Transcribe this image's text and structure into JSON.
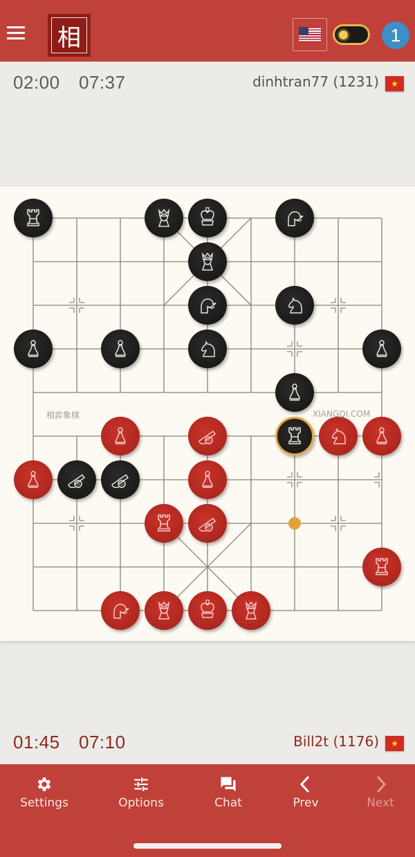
{
  "header": {
    "menu_icon": "hamburger-icon",
    "logo_char": "相",
    "language_flag": "us-flag",
    "theme_toggle": "light-dark-toggle",
    "notification_count": "1"
  },
  "top_player": {
    "clock_move": "02:00",
    "clock_total": "07:37",
    "name": "dinhtran77 (1231)",
    "flag": "vn-flag",
    "flag_star": "★"
  },
  "bottom_player": {
    "clock_move": "01:45",
    "clock_total": "07:10",
    "name": "Bill2t (1176)",
    "flag": "vn-flag",
    "flag_star": "★"
  },
  "board": {
    "watermark_left": "相弈象棋",
    "watermark_right": "XIANGQI.COM",
    "colors": {
      "red": "#b52a21",
      "black": "#1c1b19",
      "highlight": "#e4a73e",
      "line": "#8b817c"
    },
    "pieces": [
      {
        "color": "black",
        "type": "rook",
        "col": 0,
        "row": 0
      },
      {
        "color": "black",
        "type": "advisor",
        "col": 3,
        "row": 0
      },
      {
        "color": "black",
        "type": "king",
        "col": 4,
        "row": 0
      },
      {
        "color": "black",
        "type": "elephant",
        "col": 6,
        "row": 0
      },
      {
        "color": "black",
        "type": "advisor",
        "col": 4,
        "row": 1
      },
      {
        "color": "black",
        "type": "elephant",
        "col": 4,
        "row": 2
      },
      {
        "color": "black",
        "type": "horse",
        "col": 6,
        "row": 2
      },
      {
        "color": "black",
        "type": "pawn",
        "col": 0,
        "row": 3
      },
      {
        "color": "black",
        "type": "pawn",
        "col": 2,
        "row": 3
      },
      {
        "color": "black",
        "type": "horse",
        "col": 4,
        "row": 3
      },
      {
        "color": "black",
        "type": "pawn",
        "col": 8,
        "row": 3
      },
      {
        "color": "black",
        "type": "pawn",
        "col": 6,
        "row": 4
      },
      {
        "color": "red",
        "type": "pawn",
        "col": 2,
        "row": 5
      },
      {
        "color": "red",
        "type": "cannon",
        "col": 4,
        "row": 5
      },
      {
        "color": "black",
        "type": "rook",
        "col": 6,
        "row": 5,
        "selected": true
      },
      {
        "color": "red",
        "type": "horse",
        "col": 7,
        "row": 5
      },
      {
        "color": "red",
        "type": "pawn",
        "col": 8,
        "row": 5
      },
      {
        "color": "red",
        "type": "pawn",
        "col": 0,
        "row": 6
      },
      {
        "color": "black",
        "type": "cannon",
        "col": 1,
        "row": 6
      },
      {
        "color": "black",
        "type": "cannon",
        "col": 2,
        "row": 6
      },
      {
        "color": "red",
        "type": "pawn",
        "col": 4,
        "row": 6
      },
      {
        "color": "red",
        "type": "rook",
        "col": 3,
        "row": 7
      },
      {
        "color": "red",
        "type": "cannon",
        "col": 4,
        "row": 7
      },
      {
        "color": "red",
        "type": "rook",
        "col": 8,
        "row": 8
      },
      {
        "color": "red",
        "type": "elephant",
        "col": 2,
        "row": 9
      },
      {
        "color": "red",
        "type": "advisor",
        "col": 3,
        "row": 9
      },
      {
        "color": "red",
        "type": "king",
        "col": 4,
        "row": 9
      },
      {
        "color": "red",
        "type": "advisor",
        "col": 5,
        "row": 9
      }
    ],
    "last_move_dot": {
      "col": 6,
      "row": 7
    }
  },
  "bottom_nav": [
    {
      "label": "Settings",
      "icon": "gear-icon",
      "enabled": true
    },
    {
      "label": "Options",
      "icon": "sliders-icon",
      "enabled": true
    },
    {
      "label": "Chat",
      "icon": "chat-icon",
      "enabled": true
    },
    {
      "label": "Prev",
      "icon": "chevron-left-icon",
      "enabled": true
    },
    {
      "label": "Next",
      "icon": "chevron-right-icon",
      "enabled": false
    }
  ]
}
